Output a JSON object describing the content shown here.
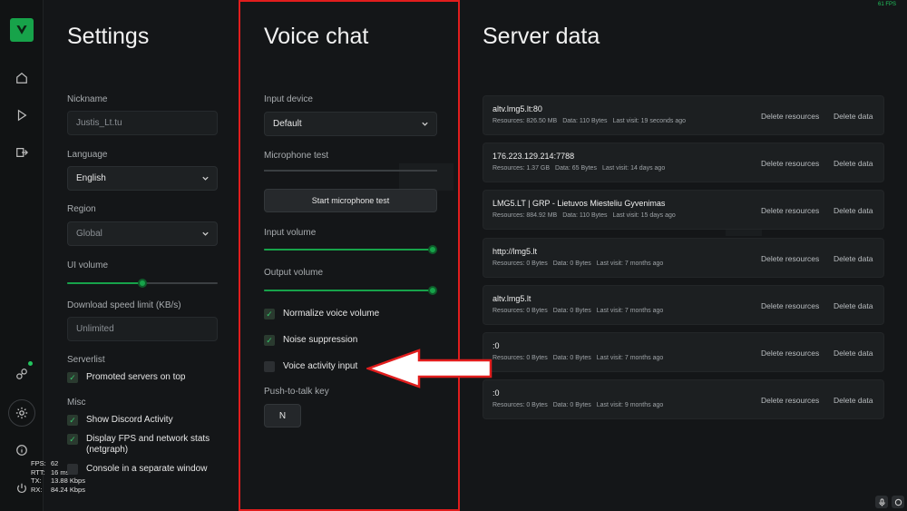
{
  "overlay": {
    "fps_top": "61 FPS"
  },
  "netstats": [
    {
      "k": "FPS:",
      "v": "62"
    },
    {
      "k": "RTT:",
      "v": "16 ms"
    },
    {
      "k": "TX:",
      "v": "13.88 Kbps"
    },
    {
      "k": "RX:",
      "v": "84.24 Kbps"
    }
  ],
  "settings": {
    "title": "Settings",
    "nickname_label": "Nickname",
    "nickname_value": "Justis_Lt.tu",
    "language_label": "Language",
    "language_value": "English",
    "region_label": "Region",
    "region_value": "Global",
    "ui_volume_label": "UI volume",
    "ui_volume_level": 0.5,
    "download_label": "Download speed limit (KB/s)",
    "download_value": "Unlimited",
    "serverlist_label": "Serverlist",
    "promoted_label": "Promoted servers on top",
    "misc_label": "Misc",
    "discord_label": "Show Discord Activity",
    "fps_stats_label": "Display FPS and network stats (netgraph)",
    "console_label": "Console in a separate window"
  },
  "voice": {
    "title": "Voice chat",
    "input_device_label": "Input device",
    "input_device_value": "Default",
    "mic_test_label": "Microphone test",
    "mic_test_button": "Start microphone test",
    "input_volume_label": "Input volume",
    "input_volume_level": 1.0,
    "output_volume_label": "Output volume",
    "output_volume_level": 1.0,
    "normalize_label": "Normalize voice volume",
    "noise_label": "Noise suppression",
    "activity_label": "Voice activity input",
    "ptt_label": "Push-to-talk key",
    "ptt_key": "N"
  },
  "server_data": {
    "title": "Server data",
    "delete_resources": "Delete resources",
    "delete_data": "Delete data",
    "servers": [
      {
        "name": "altv.lmg5.lt:80",
        "resources": "Resources: 826.50 MB",
        "data": "Data: 110 Bytes",
        "visit": "Last visit: 19 seconds ago"
      },
      {
        "name": "176.223.129.214:7788",
        "resources": "Resources: 1.37 GB",
        "data": "Data: 65 Bytes",
        "visit": "Last visit: 14 days ago"
      },
      {
        "name": "LMG5.LT | GRP - Lietuvos Miesteliu Gyvenimas",
        "resources": "Resources: 884.92 MB",
        "data": "Data: 110 Bytes",
        "visit": "Last visit: 15 days ago"
      },
      {
        "name": "http://lmg5.lt",
        "resources": "Resources: 0 Bytes",
        "data": "Data: 0 Bytes",
        "visit": "Last visit: 7 months ago"
      },
      {
        "name": "altv.lmg5.lt",
        "resources": "Resources: 0 Bytes",
        "data": "Data: 0 Bytes",
        "visit": "Last visit: 7 months ago"
      },
      {
        "name": ":0",
        "resources": "Resources: 0 Bytes",
        "data": "Data: 0 Bytes",
        "visit": "Last visit: 7 months ago"
      },
      {
        "name": ":0",
        "resources": "Resources: 0 Bytes",
        "data": "Data: 0 Bytes",
        "visit": "Last visit: 9 months ago"
      }
    ]
  },
  "colors": {
    "accent": "#17a34a",
    "highlight": "#e11d1d"
  }
}
